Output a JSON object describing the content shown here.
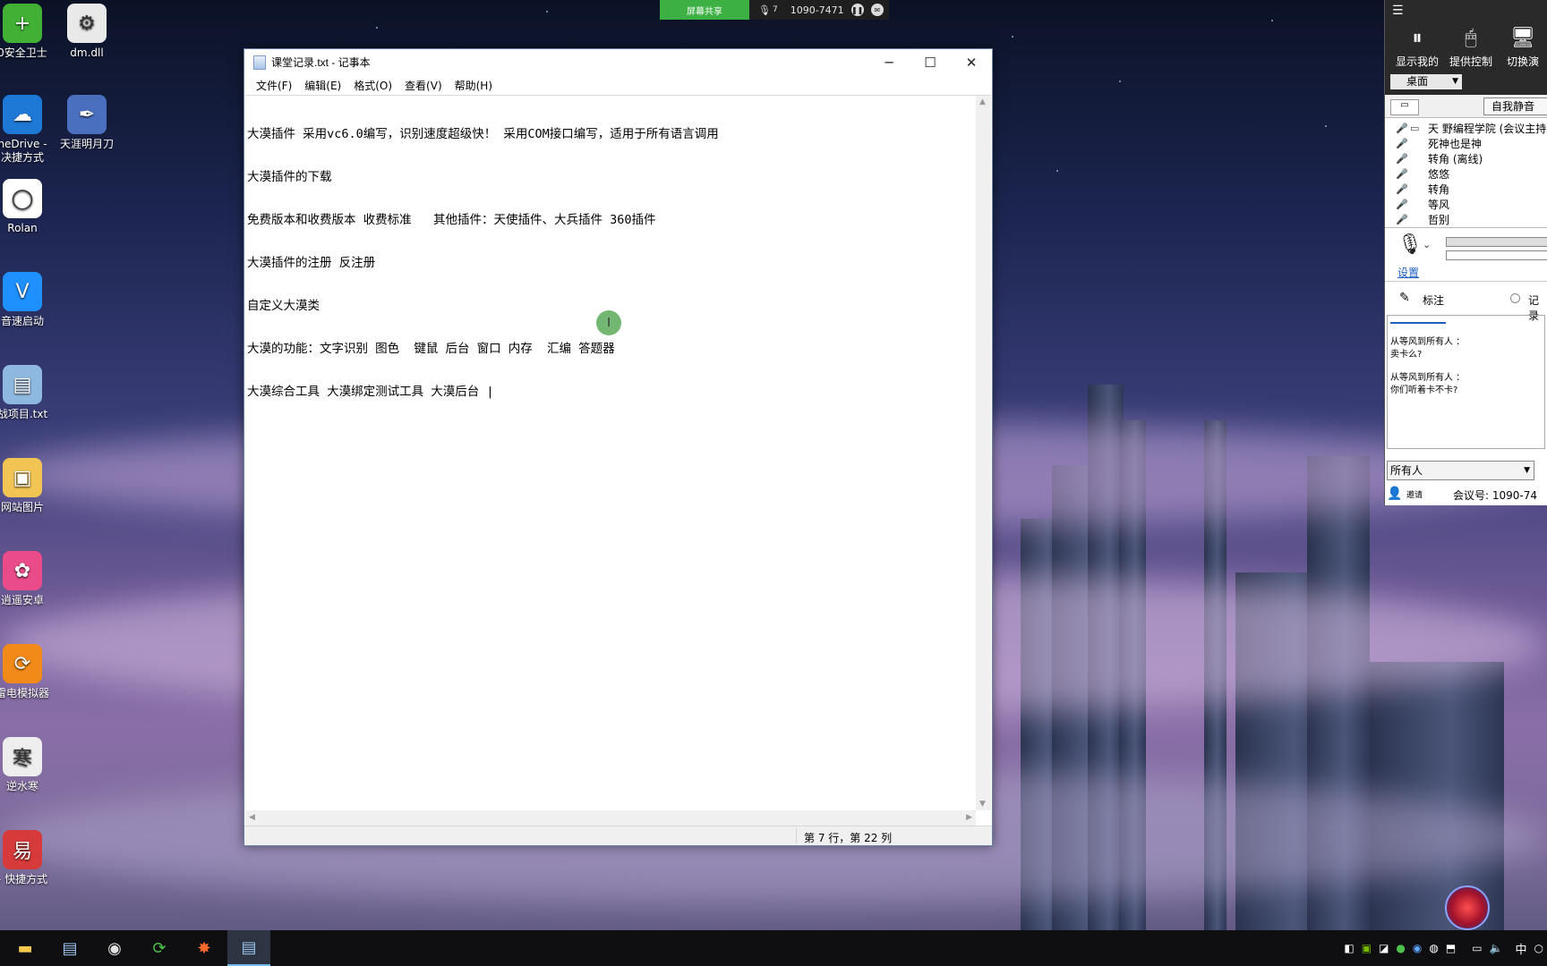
{
  "desktop": {
    "icons": [
      {
        "label": "0安全卫士",
        "color": "#42b035",
        "glyph": "+"
      },
      {
        "label": "dm.dll",
        "color": "#e9e9e9",
        "glyph": "⚙"
      },
      {
        "label": "neDrive -\n决捷方式",
        "color": "#1e78d6",
        "glyph": "☁"
      },
      {
        "label": "天涯明月刀",
        "color": "#4a6fbf",
        "glyph": "✒"
      },
      {
        "label": "Rolan",
        "color": "#ffffff",
        "glyph": "◯"
      },
      {
        "label": "音速启动",
        "color": "#1e90ff",
        "glyph": "V"
      },
      {
        "label": "战项目.txt",
        "color": "#8fb8e0",
        "glyph": "▤"
      },
      {
        "label": "网站图片",
        "color": "#f1c453",
        "glyph": "▣"
      },
      {
        "label": "逍遥安卓",
        "color": "#e94c89",
        "glyph": "✿"
      },
      {
        "label": "雷电模拟器",
        "color": "#f28a1a",
        "glyph": "⟳"
      },
      {
        "label": "逆水寒",
        "color": "#eeeeee",
        "glyph": "寒"
      },
      {
        "label": "- 快捷方式",
        "color": "#d63a3a",
        "glyph": "易"
      }
    ]
  },
  "meeting_bar": {
    "share_label": "屏幕共享",
    "mic_count": "7",
    "meeting_id": "1090-7471"
  },
  "notepad": {
    "title": "课堂记录.txt - 记事本",
    "menu": [
      "文件(F)",
      "编辑(E)",
      "格式(O)",
      "查看(V)",
      "帮助(H)"
    ],
    "lines": [
      "大漠插件 采用vc6.0编写，识别速度超级快！ 采用COM接口编写，适用于所有语言调用",
      "大漠插件的下载",
      "免费版本和收费版本 收费标准   其他插件：天使插件、大兵插件 360插件",
      "大漠插件的注册 反注册",
      "自定义大漠类",
      "大漠的功能：文字识别 图色  键鼠 后台 窗口 内存  汇编 答题器",
      "大漠综合工具 大漠绑定测试工具 大漠后台 |"
    ],
    "status": "第 7 行，第 22 列"
  },
  "panel": {
    "buttons": [
      "显示我的",
      "提供控制",
      "切换演"
    ],
    "desktop_select": "桌面",
    "mute_label": "自我静音",
    "participants": [
      "天 野编程学院 (会议主持",
      "死神也是神",
      "转角 (离线)",
      "悠悠",
      "转角",
      "等风",
      "哲别"
    ],
    "settings_link": "设置",
    "annotate_label": "标注",
    "record_label": "记录",
    "chat": [
      {
        "from": "从等风到所有人 ：",
        "text": "卖卡么?"
      },
      {
        "from": "从等风到所有人 ：",
        "text": "你们听着卡不卡?"
      }
    ],
    "chat_target": "所有人",
    "invite_label": "邀请",
    "meeting_no": "会议号: 1090-74"
  },
  "tray": {
    "ime": "中"
  }
}
